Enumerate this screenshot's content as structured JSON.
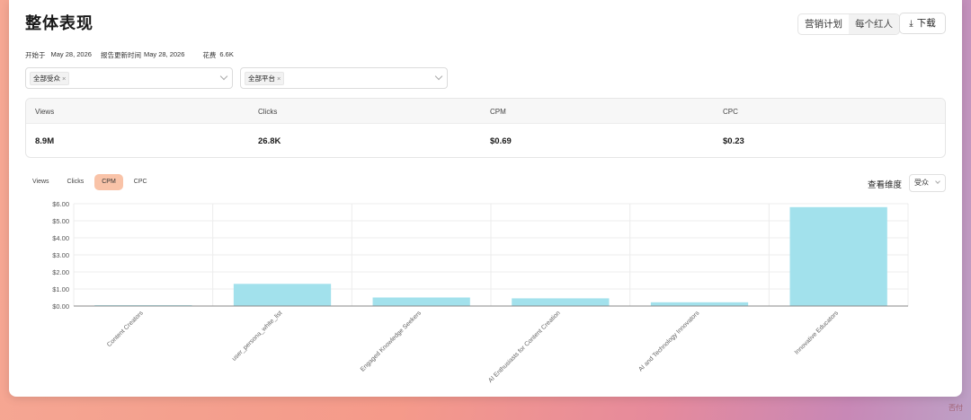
{
  "header": {
    "title": "整体表现",
    "seg_options": [
      "营销计划",
      "每个红人"
    ],
    "download_label": "下载"
  },
  "meta": {
    "start_label": "开始于",
    "start_date": "May 28, 2026",
    "update_label": "报告更新时间",
    "update_date": "May 28, 2026",
    "spend_label": "花费",
    "spend_value": "6.6K"
  },
  "filters": {
    "audience_tag": "全部受众",
    "platform_tag": "全部平台"
  },
  "metrics": [
    {
      "label": "Views",
      "value": "8.9M"
    },
    {
      "label": "Clicks",
      "value": "26.8K"
    },
    {
      "label": "CPM",
      "value": "$0.69"
    },
    {
      "label": "CPC",
      "value": "$0.23"
    }
  ],
  "chart_tabs": [
    "Views",
    "Clicks",
    "CPM",
    "CPC"
  ],
  "active_tab": "CPM",
  "dimension": {
    "label": "查看维度",
    "value": "受众"
  },
  "watermark": "否付",
  "chart_data": {
    "type": "bar",
    "categories": [
      "Content Creators",
      "user_persona_white_list",
      "Engaged Knowledge Seekers",
      "AI Enthusiasts for Content Creation",
      "AI and Technology Innovators",
      "Innovative Educators"
    ],
    "values": [
      0.05,
      1.3,
      0.5,
      0.45,
      0.22,
      5.8
    ],
    "ylim": [
      0,
      6
    ],
    "yticks": [
      "$0.00",
      "$1.00",
      "$2.00",
      "$3.00",
      "$4.00",
      "$5.00",
      "$6.00"
    ],
    "bar_color": "#a2e1ec",
    "grid": true
  }
}
